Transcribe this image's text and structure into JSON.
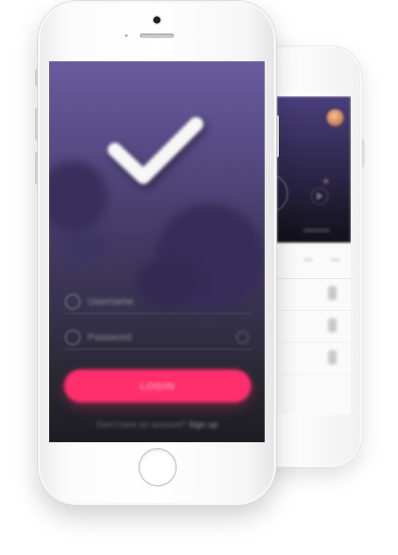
{
  "back_phone": {
    "colors": {
      "header_top": "#4a3f7c",
      "header_bottom": "#121018",
      "body": "#fafafa"
    }
  },
  "front_phone": {
    "screen": {
      "colors": {
        "top": "#6a5a9e",
        "bottom": "#1d1c22",
        "accent": "#ff2e6c"
      },
      "icon": "checkmark-icon",
      "fields": [
        {
          "icon": "user-icon",
          "value": "Username"
        },
        {
          "icon": "lock-icon",
          "value": "Password",
          "trailing_icon": "eye-icon"
        }
      ],
      "login_button": {
        "label": "LOGIN"
      },
      "footer": {
        "text": "Don't have an account?",
        "link": "Sign up"
      }
    }
  }
}
